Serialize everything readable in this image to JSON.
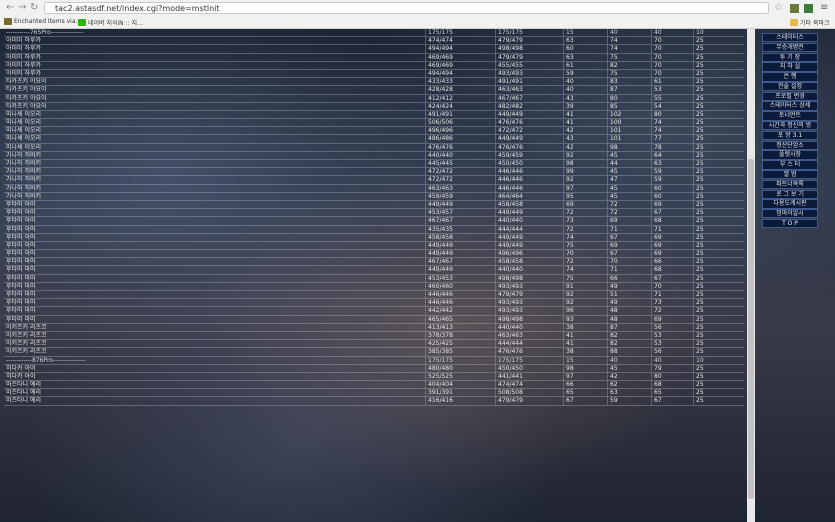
{
  "browser": {
    "url": "tac2.astasdf.net/index.cgi?mode=mstlnit",
    "bookmarks": [
      {
        "label": "Enchanted Items via...",
        "color": "#7a6a2a"
      },
      {
        "label": "네이버 지식iN :: 지...",
        "color": "#2db400"
      }
    ],
    "other_bookmarks": "기타 북마크"
  },
  "table": {
    "rows": [
      {
        "name": "-----------765Pro---------------",
        "c1": "175/175",
        "c2": "175/175",
        "c3": "15",
        "c4": "40",
        "c5": "40",
        "c6": "10"
      },
      {
        "name": "아미미 하루카",
        "c1": "474/474",
        "c2": "479/479",
        "c3": "63",
        "c4": "74",
        "c5": "70",
        "c6": "25"
      },
      {
        "name": "아미미 하루카",
        "c1": "494/494",
        "c2": "498/498",
        "c3": "60",
        "c4": "74",
        "c5": "70",
        "c6": "25"
      },
      {
        "name": "아미미 하루카",
        "c1": "469/469",
        "c2": "479/479",
        "c3": "63",
        "c4": "75",
        "c5": "70",
        "c6": "25"
      },
      {
        "name": "아미미 하루카",
        "c1": "469/469",
        "c2": "455/455",
        "c3": "61",
        "c4": "82",
        "c5": "70",
        "c6": "25"
      },
      {
        "name": "아미미 하루카",
        "c1": "494/494",
        "c2": "493/493",
        "c3": "59",
        "c4": "75",
        "c5": "70",
        "c6": "25"
      },
      {
        "name": "타카츠키 야요이",
        "c1": "433/433",
        "c2": "491/491",
        "c3": "40",
        "c4": "83",
        "c5": "61",
        "c6": "25"
      },
      {
        "name": "타카츠키 야요이",
        "c1": "428/428",
        "c2": "463/463",
        "c3": "40",
        "c4": "87",
        "c5": "53",
        "c6": "25"
      },
      {
        "name": "타카츠키 야요이",
        "c1": "412/412",
        "c2": "467/467",
        "c3": "43",
        "c4": "80",
        "c5": "55",
        "c6": "25"
      },
      {
        "name": "타카츠키 야요이",
        "c1": "424/424",
        "c2": "482/482",
        "c3": "39",
        "c4": "85",
        "c5": "54",
        "c6": "25"
      },
      {
        "name": "미나세 이오리",
        "c1": "491/491",
        "c2": "449/449",
        "c3": "41",
        "c4": "102",
        "c5": "80",
        "c6": "25"
      },
      {
        "name": "미나세 이오리",
        "c1": "506/506",
        "c2": "476/476",
        "c3": "41",
        "c4": "100",
        "c5": "74",
        "c6": "25"
      },
      {
        "name": "미나세 이오리",
        "c1": "496/496",
        "c2": "472/472",
        "c3": "42",
        "c4": "101",
        "c5": "74",
        "c6": "25"
      },
      {
        "name": "미나세 이오리",
        "c1": "486/486",
        "c2": "449/449",
        "c3": "43",
        "c4": "101",
        "c5": "77",
        "c6": "25"
      },
      {
        "name": "미나세 이오리",
        "c1": "476/476",
        "c2": "476/476",
        "c3": "42",
        "c4": "98",
        "c5": "78",
        "c6": "25"
      },
      {
        "name": "가나하 히비키",
        "c1": "440/440",
        "c2": "459/459",
        "c3": "92",
        "c4": "45",
        "c5": "64",
        "c6": "25"
      },
      {
        "name": "가나하 히비키",
        "c1": "445/445",
        "c2": "450/450",
        "c3": "98",
        "c4": "44",
        "c5": "63",
        "c6": "25"
      },
      {
        "name": "가나하 히비키",
        "c1": "472/472",
        "c2": "446/446",
        "c3": "99",
        "c4": "45",
        "c5": "59",
        "c6": "25"
      },
      {
        "name": "가나하 히비키",
        "c1": "472/472",
        "c2": "446/446",
        "c3": "92",
        "c4": "47",
        "c5": "59",
        "c6": "25"
      },
      {
        "name": "가나하 히비키",
        "c1": "463/463",
        "c2": "446/446",
        "c3": "97",
        "c4": "45",
        "c5": "60",
        "c6": "25"
      },
      {
        "name": "가나하 히비키",
        "c1": "459/459",
        "c2": "464/464",
        "c3": "95",
        "c4": "45",
        "c5": "60",
        "c6": "25"
      },
      {
        "name": "후타미 아미",
        "c1": "449/449",
        "c2": "458/458",
        "c3": "69",
        "c4": "72",
        "c5": "69",
        "c6": "25"
      },
      {
        "name": "후타미 아미",
        "c1": "453/457",
        "c2": "449/449",
        "c3": "72",
        "c4": "72",
        "c5": "67",
        "c6": "25"
      },
      {
        "name": "후타미 아미",
        "c1": "467/467",
        "c2": "440/440",
        "c3": "73",
        "c4": "69",
        "c5": "68",
        "c6": "25"
      },
      {
        "name": "후타미 아미",
        "c1": "435/435",
        "c2": "444/444",
        "c3": "72",
        "c4": "71",
        "c5": "71",
        "c6": "25"
      },
      {
        "name": "후타미 아미",
        "c1": "458/458",
        "c2": "449/449",
        "c3": "74",
        "c4": "67",
        "c5": "69",
        "c6": "25"
      },
      {
        "name": "후타미 아미",
        "c1": "449/449",
        "c2": "449/449",
        "c3": "75",
        "c4": "69",
        "c5": "69",
        "c6": "25"
      },
      {
        "name": "후타미 아미",
        "c1": "449/449",
        "c2": "496/496",
        "c3": "70",
        "c4": "67",
        "c5": "69",
        "c6": "25"
      },
      {
        "name": "후타미 마미",
        "c1": "467/467",
        "c2": "458/458",
        "c3": "72",
        "c4": "70",
        "c5": "66",
        "c6": "25"
      },
      {
        "name": "후타미 마미",
        "c1": "449/449",
        "c2": "440/440",
        "c3": "74",
        "c4": "71",
        "c5": "68",
        "c6": "25"
      },
      {
        "name": "후타미 마미",
        "c1": "453/453",
        "c2": "498/498",
        "c3": "75",
        "c4": "66",
        "c5": "67",
        "c6": "25"
      },
      {
        "name": "후타미 마미",
        "c1": "460/460",
        "c2": "493/493",
        "c3": "91",
        "c4": "49",
        "c5": "70",
        "c6": "25"
      },
      {
        "name": "후타미 마미",
        "c1": "446/446",
        "c2": "479/479",
        "c3": "92",
        "c4": "51",
        "c5": "71",
        "c6": "25"
      },
      {
        "name": "후타미 마미",
        "c1": "446/446",
        "c2": "493/493",
        "c3": "92",
        "c4": "49",
        "c5": "73",
        "c6": "25"
      },
      {
        "name": "후타미 마미",
        "c1": "442/442",
        "c2": "493/493",
        "c3": "96",
        "c4": "48",
        "c5": "72",
        "c6": "25"
      },
      {
        "name": "후타미 마미",
        "c1": "465/465",
        "c2": "498/498",
        "c3": "93",
        "c4": "48",
        "c5": "69",
        "c6": "25"
      },
      {
        "name": "아키즈키 리츠코",
        "c1": "413/413",
        "c2": "440/440",
        "c3": "38",
        "c4": "87",
        "c5": "56",
        "c6": "25"
      },
      {
        "name": "아키즈키 리츠코",
        "c1": "378/378",
        "c2": "463/463",
        "c3": "41",
        "c4": "82",
        "c5": "53",
        "c6": "25"
      },
      {
        "name": "아키즈키 리츠코",
        "c1": "425/425",
        "c2": "444/444",
        "c3": "41",
        "c4": "82",
        "c5": "53",
        "c6": "25"
      },
      {
        "name": "아키즈키 리츠코",
        "c1": "385/385",
        "c2": "476/476",
        "c3": "38",
        "c4": "88",
        "c5": "56",
        "c6": "25"
      },
      {
        "name": "------------876Pro---------------",
        "c1": "175/175",
        "c2": "175/175",
        "c3": "15",
        "c4": "40",
        "c5": "40",
        "c6": "10"
      },
      {
        "name": "히다카 아이",
        "c1": "480/480",
        "c2": "450/450",
        "c3": "98",
        "c4": "45",
        "c5": "79",
        "c6": "25"
      },
      {
        "name": "히다카 아이",
        "c1": "525/525",
        "c2": "441/441",
        "c3": "97",
        "c4": "42",
        "c5": "80",
        "c6": "25"
      },
      {
        "name": "미즈타니 에리",
        "c1": "404/404",
        "c2": "474/474",
        "c3": "66",
        "c4": "62",
        "c5": "68",
        "c6": "25"
      },
      {
        "name": "미즈타니 에리",
        "c1": "391/391",
        "c2": "508/508",
        "c3": "65",
        "c4": "63",
        "c5": "65",
        "c6": "25"
      },
      {
        "name": "미즈타니 에리",
        "c1": "416/416",
        "c2": "479/479",
        "c3": "67",
        "c4": "59",
        "c5": "67",
        "c6": "25"
      }
    ]
  },
  "menu": [
    "스테이터스",
    "무승개병전",
    "투 기 장",
    "지 하 실",
    "은 행",
    "전술 설정",
    "프로필 변경",
    "스테이터스 상세",
    "토너먼트",
    "시간과 정신의 방",
    "포 방 3.1",
    "정산단암소",
    "플렛시장",
    "부 스 터",
    "앨 범",
    "파트너목록",
    "로 그 보 기",
    "다용도게시판",
    "밈마이알시",
    "T O P"
  ]
}
